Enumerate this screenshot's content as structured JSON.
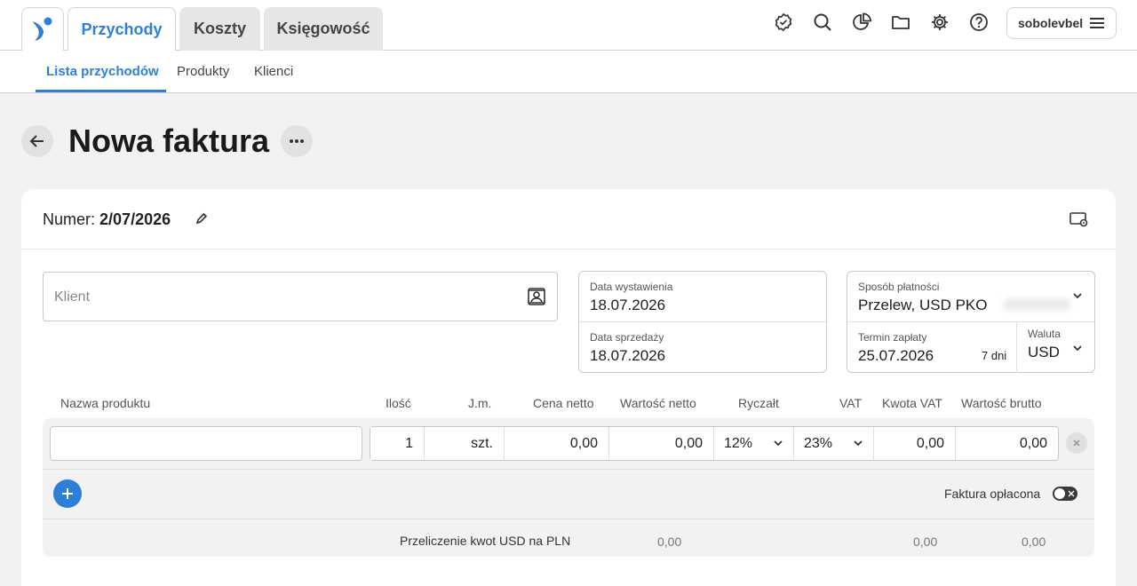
{
  "tabs": [
    {
      "label": "Przychody",
      "active": true
    },
    {
      "label": "Koszty",
      "active": false
    },
    {
      "label": "Księgowość",
      "active": false
    }
  ],
  "toolbar_icons": [
    "badge-check-icon",
    "search-icon",
    "pie-chart-icon",
    "folder-icon",
    "gear-icon",
    "help-icon"
  ],
  "user": {
    "name": "sobolevbel"
  },
  "subnav": [
    {
      "label": "Lista przychodów",
      "active": true
    },
    {
      "label": "Produkty",
      "active": false
    },
    {
      "label": "Klienci",
      "active": false
    }
  ],
  "page": {
    "title": "Nowa faktura"
  },
  "invoice": {
    "number_label": "Numer:",
    "number": "2/07/2026",
    "client_placeholder": "Klient",
    "issue_date_label": "Data wystawienia",
    "issue_date": "18.07.2026",
    "sale_date_label": "Data sprzedaży",
    "sale_date": "18.07.2026",
    "payment_method_label": "Sposób płatności",
    "payment_method": "Przelew, USD PKO",
    "due_label": "Termin zapłaty",
    "due_date": "25.07.2026",
    "due_days": "7 dni",
    "currency_label": "Waluta",
    "currency": "USD"
  },
  "table": {
    "headers": {
      "name": "Nazwa produktu",
      "qty": "Ilość",
      "unit": "J.m.",
      "net_price": "Cena netto",
      "net_value": "Wartość netto",
      "lump": "Ryczałt",
      "vat": "VAT",
      "vat_amount": "Kwota VAT",
      "gross": "Wartość brutto"
    },
    "row": {
      "name": "",
      "qty": "1",
      "unit": "szt.",
      "net_price": "0,00",
      "net_value": "0,00",
      "lump": "12%",
      "vat": "23%",
      "vat_amount": "0,00",
      "gross": "0,00"
    }
  },
  "paid_label": "Faktura opłacona",
  "paid": false,
  "conversion": {
    "label": "Przeliczenie kwot USD na PLN",
    "net": "0,00",
    "vat": "0,00",
    "gross": "0,00"
  },
  "colors": {
    "accent": "#2e7fd8",
    "background": "#f2f2f3"
  }
}
